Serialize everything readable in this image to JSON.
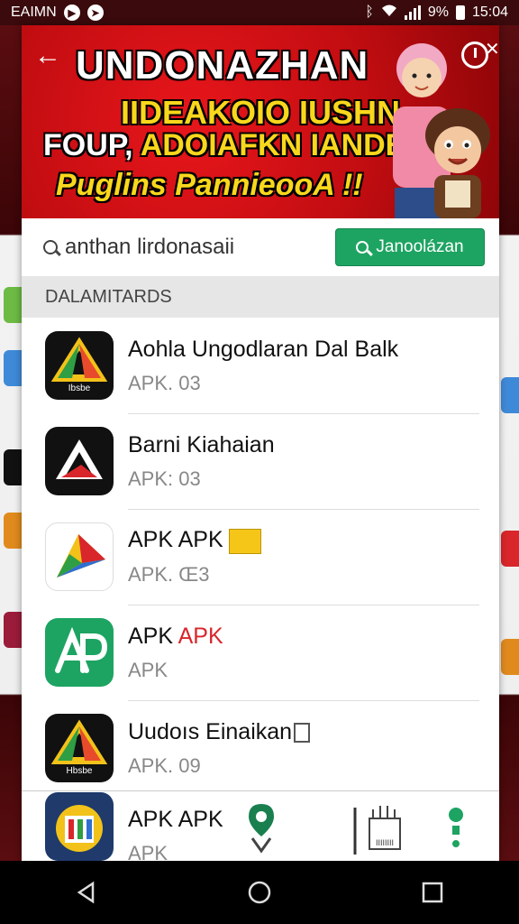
{
  "status_bar": {
    "left_text": "EAIMN",
    "battery_text": "9%",
    "time": "15:04"
  },
  "banner": {
    "title": "UNDONAZHAN",
    "line2": "IIDEAKOIO IUSHN,",
    "line3_white": "FOUP,",
    "line3_yellow": "ADOIAFKN IANDEA",
    "line4": "Puglins  PannieooA !!",
    "back_icon": "back-arrow-icon",
    "search_icon": "search-icon"
  },
  "search": {
    "value": "anthan lirdonasaii",
    "button_label": "Janoolázan"
  },
  "section": {
    "title": "DALAMITARDS"
  },
  "apps": [
    {
      "name": "Aohla Ungodlaran Dal Balk",
      "meta": "APK. 03",
      "icon_text": "Ibsbe"
    },
    {
      "name": "Barni Kiahaian",
      "meta": "APK: 03"
    },
    {
      "name": "APK APK",
      "meta": "APK. Œ3"
    },
    {
      "name": "APK",
      "name_accent": "APK",
      "meta": "APK"
    },
    {
      "name": "Uudoıs Einaikan",
      "meta": "APK. 09",
      "icon_text": "Hbsbe"
    }
  ],
  "last_app": {
    "name": "APK APK",
    "meta": "APK",
    "tool_label": "IIIIIIII"
  },
  "colors": {
    "banner_red": "#c20d11",
    "accent_green": "#1da462",
    "accent_red": "#d8262b",
    "banner_yellow": "#f9d71c"
  }
}
